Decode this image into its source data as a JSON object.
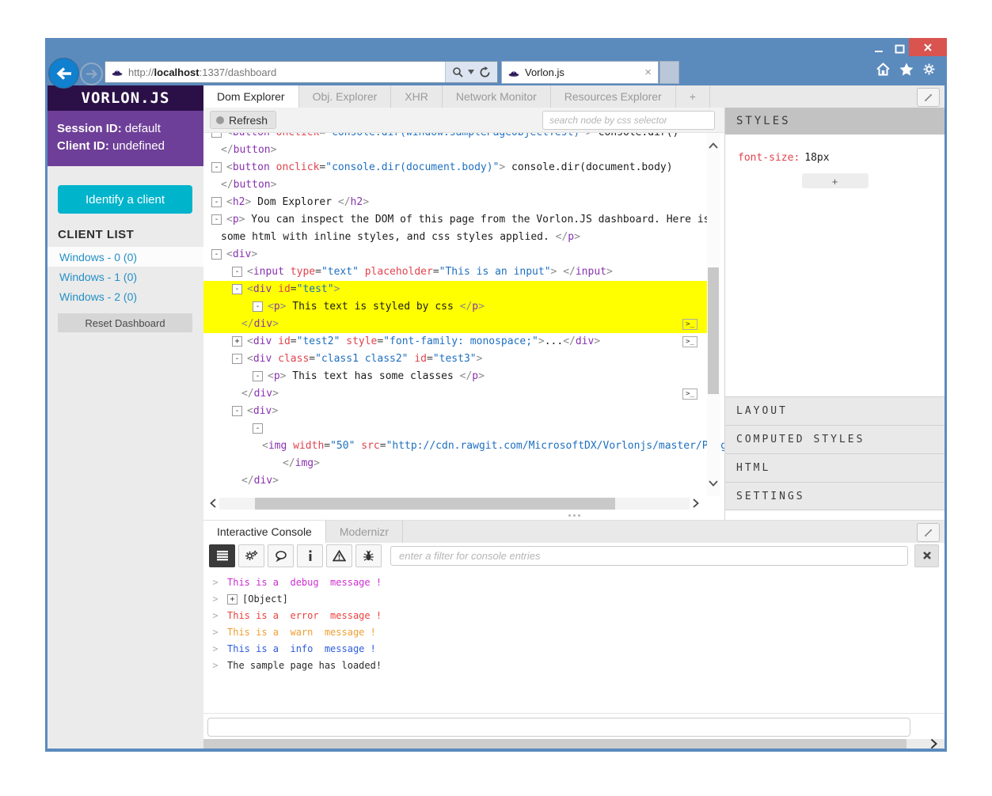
{
  "browser": {
    "url": {
      "protocol": "http://",
      "host": "localhost",
      "path": ":1337/dashboard"
    },
    "tab_title": "Vorlon.js"
  },
  "sidebar": {
    "logo": "VORLON.JS",
    "session_label": "Session ID:",
    "session_value": "default",
    "client_label": "Client ID:",
    "client_value": "undefined",
    "identify_button": "Identify a client",
    "client_list_title": "CLIENT LIST",
    "clients": [
      {
        "label": "Windows - 0 (0)",
        "active": true
      },
      {
        "label": "Windows - 1 (0)",
        "active": false
      },
      {
        "label": "Windows - 2 (0)",
        "active": false
      }
    ],
    "reset_button": "Reset Dashboard"
  },
  "plugin_tabs": [
    {
      "label": "Dom Explorer",
      "active": true
    },
    {
      "label": "Obj. Explorer",
      "active": false
    },
    {
      "label": "XHR",
      "active": false
    },
    {
      "label": "Network Monitor",
      "active": false
    },
    {
      "label": "Resources Explorer",
      "active": false
    },
    {
      "label": "+",
      "active": false
    }
  ],
  "dom_explorer": {
    "refresh_label": "Refresh",
    "search_placeholder": "search node by css selector",
    "console_attach_icon": ">_",
    "tree": [
      {
        "i": 0,
        "b": "-",
        "tk": [
          [
            "p",
            "<"
          ],
          [
            "t",
            "button"
          ],
          [
            "x",
            " "
          ],
          [
            "a",
            "onclick"
          ],
          [
            "e",
            "="
          ],
          [
            "v",
            "\"console.dir(window.samplePageObjectTest)\""
          ],
          [
            "p",
            ">"
          ],
          [
            "x",
            " console.dir()"
          ]
        ]
      },
      {
        "i": 0,
        "tk": [
          [
            "p",
            "</"
          ],
          [
            "t",
            "button"
          ],
          [
            "p",
            ">"
          ]
        ]
      },
      {
        "i": 0,
        "b": "-",
        "tk": [
          [
            "p",
            "<"
          ],
          [
            "t",
            "button"
          ],
          [
            "x",
            " "
          ],
          [
            "a",
            "onclick"
          ],
          [
            "e",
            "="
          ],
          [
            "v",
            "\"console.dir(document.body)\""
          ],
          [
            "p",
            ">"
          ],
          [
            "x",
            " console.dir(document.body)"
          ]
        ]
      },
      {
        "i": 0,
        "tk": [
          [
            "p",
            "</"
          ],
          [
            "t",
            "button"
          ],
          [
            "p",
            ">"
          ]
        ]
      },
      {
        "i": 0,
        "b": "-",
        "tk": [
          [
            "p",
            "<"
          ],
          [
            "t",
            "h2"
          ],
          [
            "p",
            ">"
          ],
          [
            "x",
            " Dom Explorer "
          ],
          [
            "p",
            "</"
          ],
          [
            "t",
            "h2"
          ],
          [
            "p",
            ">"
          ]
        ]
      },
      {
        "i": 0,
        "b": "-",
        "tk": [
          [
            "p",
            "<"
          ],
          [
            "t",
            "p"
          ],
          [
            "p",
            ">"
          ],
          [
            "x",
            " You can inspect the DOM of this page from the Vorlon.JS dashboard. Here is"
          ]
        ]
      },
      {
        "i": 0,
        "wrap": true,
        "tk": [
          [
            "x",
            "some html with inline styles, and css styles applied. "
          ],
          [
            "p",
            "</"
          ],
          [
            "t",
            "p"
          ],
          [
            "p",
            ">"
          ]
        ]
      },
      {
        "i": 0,
        "b": "-",
        "tk": [
          [
            "p",
            "<"
          ],
          [
            "t",
            "div"
          ],
          [
            "p",
            ">"
          ]
        ]
      },
      {
        "i": 1,
        "b": "-",
        "tk": [
          [
            "p",
            "<"
          ],
          [
            "t",
            "input"
          ],
          [
            "x",
            " "
          ],
          [
            "a",
            "type"
          ],
          [
            "e",
            "="
          ],
          [
            "v",
            "\"text\""
          ],
          [
            "x",
            " "
          ],
          [
            "a",
            "placeholder"
          ],
          [
            "e",
            "="
          ],
          [
            "v",
            "\"This is an input\""
          ],
          [
            "p",
            ">"
          ],
          [
            "x",
            " "
          ],
          [
            "p",
            "</"
          ],
          [
            "t",
            "input"
          ],
          [
            "p",
            ">"
          ]
        ]
      },
      {
        "i": 1,
        "b": "-",
        "hl": true,
        "tk": [
          [
            "p",
            "<"
          ],
          [
            "t",
            "div"
          ],
          [
            "x",
            " "
          ],
          [
            "a",
            "id"
          ],
          [
            "e",
            "="
          ],
          [
            "v",
            "\"test\""
          ],
          [
            "p",
            ">"
          ]
        ]
      },
      {
        "i": 2,
        "b": "-",
        "hl": true,
        "tk": [
          [
            "p",
            "<"
          ],
          [
            "t",
            "p"
          ],
          [
            "p",
            ">"
          ],
          [
            "x",
            " This text is styled by css "
          ],
          [
            "p",
            "</"
          ],
          [
            "t",
            "p"
          ],
          [
            "p",
            ">"
          ]
        ]
      },
      {
        "i": 1,
        "hl": true,
        "btn": true,
        "tk": [
          [
            "p",
            "</"
          ],
          [
            "t",
            "div"
          ],
          [
            "p",
            ">"
          ]
        ]
      },
      {
        "i": 1,
        "b": "+",
        "btn": true,
        "tk": [
          [
            "p",
            "<"
          ],
          [
            "t",
            "div"
          ],
          [
            "x",
            " "
          ],
          [
            "a",
            "id"
          ],
          [
            "e",
            "="
          ],
          [
            "v",
            "\"test2\""
          ],
          [
            "x",
            " "
          ],
          [
            "a",
            "style"
          ],
          [
            "e",
            "="
          ],
          [
            "v",
            "\"font-family: monospace;\""
          ],
          [
            "p",
            ">"
          ],
          [
            "x",
            "..."
          ],
          [
            "p",
            "</"
          ],
          [
            "t",
            "div"
          ],
          [
            "p",
            ">"
          ]
        ]
      },
      {
        "i": 1,
        "b": "-",
        "tk": [
          [
            "p",
            "<"
          ],
          [
            "t",
            "div"
          ],
          [
            "x",
            " "
          ],
          [
            "a",
            "class"
          ],
          [
            "e",
            "="
          ],
          [
            "v",
            "\"class1 class2\""
          ],
          [
            "x",
            " "
          ],
          [
            "a",
            "id"
          ],
          [
            "e",
            "="
          ],
          [
            "v",
            "\"test3\""
          ],
          [
            "p",
            ">"
          ]
        ]
      },
      {
        "i": 2,
        "b": "-",
        "tk": [
          [
            "p",
            "<"
          ],
          [
            "t",
            "p"
          ],
          [
            "p",
            ">"
          ],
          [
            "x",
            " This text has some classes "
          ],
          [
            "p",
            "</"
          ],
          [
            "t",
            "p"
          ],
          [
            "p",
            ">"
          ]
        ]
      },
      {
        "i": 1,
        "btn": true,
        "tk": [
          [
            "p",
            "</"
          ],
          [
            "t",
            "div"
          ],
          [
            "p",
            ">"
          ]
        ]
      },
      {
        "i": 1,
        "b": "-",
        "tk": [
          [
            "p",
            "<"
          ],
          [
            "t",
            "div"
          ],
          [
            "p",
            ">"
          ]
        ]
      },
      {
        "i": 2,
        "b": "-",
        "tk": []
      },
      {
        "i": 2,
        "wrap": true,
        "tk": [
          [
            "p",
            "<"
          ],
          [
            "t",
            "img"
          ],
          [
            "x",
            " "
          ],
          [
            "a",
            "width"
          ],
          [
            "e",
            "="
          ],
          [
            "v",
            "\"50\""
          ],
          [
            "x",
            " "
          ],
          [
            "a",
            "src"
          ],
          [
            "e",
            "="
          ],
          [
            "v",
            "\"http://cdn.rawgit.com/MicrosoftDX/Vorlonjs/master/Plugins/"
          ]
        ]
      },
      {
        "i": 3,
        "tk": [
          [
            "p",
            "</"
          ],
          [
            "t",
            "img"
          ],
          [
            "p",
            ">"
          ]
        ]
      },
      {
        "i": 1,
        "tk": [
          [
            "p",
            "</"
          ],
          [
            "t",
            "div"
          ],
          [
            "p",
            ">"
          ]
        ]
      }
    ]
  },
  "styles_panel": {
    "title": "STYLES",
    "rule_property": "font-size:",
    "rule_value": "18px",
    "add_button": "+",
    "sections": [
      "LAYOUT",
      "COMPUTED STYLES",
      "HTML",
      "SETTINGS"
    ]
  },
  "console_panel": {
    "tabs": [
      {
        "label": "Interactive Console",
        "active": true
      },
      {
        "label": "Modernizr",
        "active": false
      }
    ],
    "filter_placeholder": "enter a filter for console entries",
    "prompt": ">",
    "entries": [
      {
        "type": "debug",
        "text": "This is a  debug  message !"
      },
      {
        "type": "object",
        "text": "[Object]",
        "expandable": true
      },
      {
        "type": "error",
        "text": "This is a  error  message !"
      },
      {
        "type": "warn",
        "text": "This is a  warn  message !"
      },
      {
        "type": "info",
        "text": "This is a  info  message !"
      },
      {
        "type": "log",
        "text": "The sample page has loaded!"
      }
    ]
  },
  "colors": {
    "chrome_blue": "#5b8abd",
    "header_purple_dark": "#2b1047",
    "header_purple": "#6e3f98",
    "accent_cyan": "#00b4cc",
    "highlight_yellow": "#ffff00",
    "close_red": "#d9534f"
  }
}
